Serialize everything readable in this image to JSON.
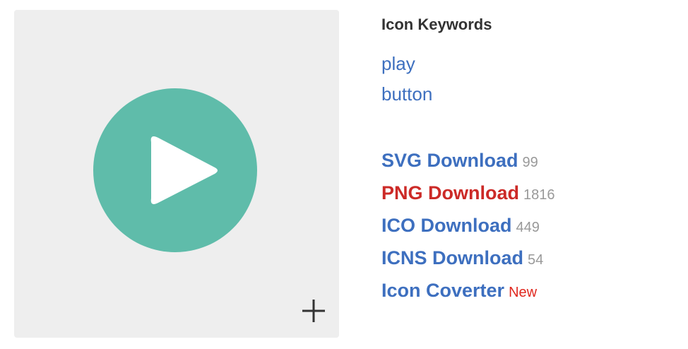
{
  "preview": {
    "icon_name": "play-button-icon",
    "circle_color": "#5fbcaa",
    "triangle_color": "#ffffff",
    "background_color": "#eeeeee",
    "add_icon_name": "plus-icon"
  },
  "keywords": {
    "title": "Icon Keywords",
    "items": [
      "play",
      "button"
    ]
  },
  "downloads": [
    {
      "label": "SVG Download",
      "count": "99",
      "color": "#3d6fbf"
    },
    {
      "label": "PNG Download",
      "count": "1816",
      "color": "#cc2a27"
    },
    {
      "label": "ICO Download",
      "count": "449",
      "color": "#3d6fbf"
    },
    {
      "label": "ICNS Download",
      "count": "54",
      "color": "#3d6fbf"
    }
  ],
  "converter": {
    "label": "Icon Coverter",
    "badge": "New"
  }
}
